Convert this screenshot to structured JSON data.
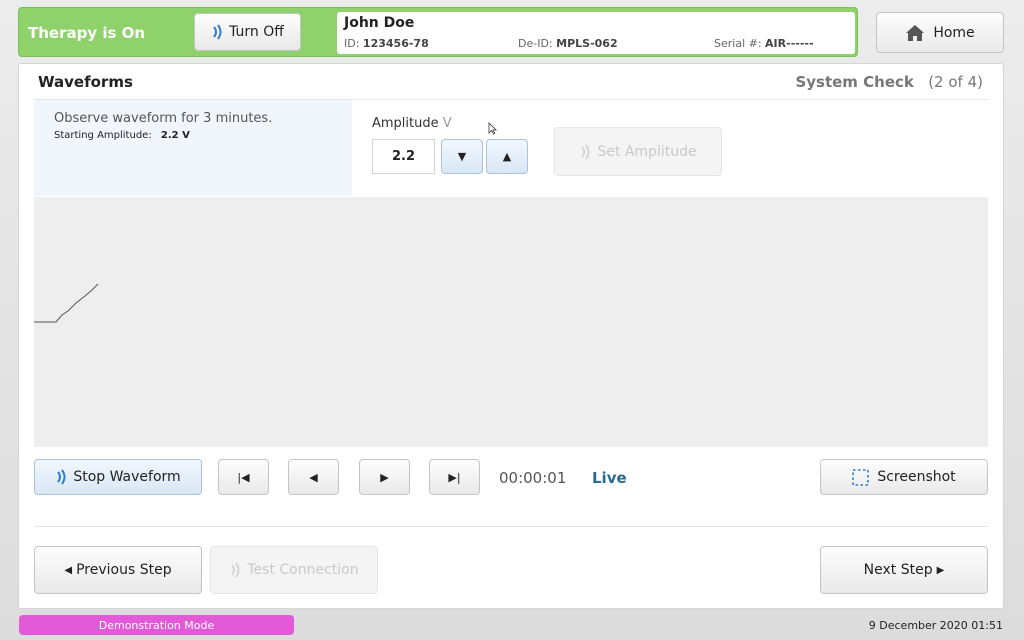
{
  "header": {
    "therapy_status": "Therapy is On",
    "turn_off_label": "Turn Off",
    "patient": {
      "name": "John Doe",
      "id_label": "ID:",
      "id_value": "123456-78",
      "deid_label": "De-ID:",
      "deid_value": "MPLS-062",
      "serial_label": "Serial #:",
      "serial_value": "AIR------"
    },
    "home_label": "Home"
  },
  "panel": {
    "title": "Waveforms",
    "step_label": "System Check",
    "step_text": "(2 of 4)",
    "instruction": "Observe waveform for 3 minutes.",
    "starting_label": "Starting Amplitude:",
    "starting_value": "2.2 V",
    "amplitude_label": "Amplitude",
    "amplitude_unit": "V",
    "amplitude_value": "2.2",
    "set_amplitude_label": "Set Amplitude",
    "stop_waveform_label": "Stop Waveform",
    "timer": "00:00:01",
    "live_label": "Live",
    "screenshot_label": "Screenshot",
    "previous_step_label": "Previous Step",
    "test_connection_label": "Test Connection",
    "next_step_label": "Next Step"
  },
  "footer": {
    "mode": "Demonstration Mode",
    "datetime": "9 December 2020 01:51"
  },
  "colors": {
    "therapy_green": "#8fd16a",
    "live_blue": "#2a6a8f",
    "demo_pink": "#e25ad7"
  }
}
